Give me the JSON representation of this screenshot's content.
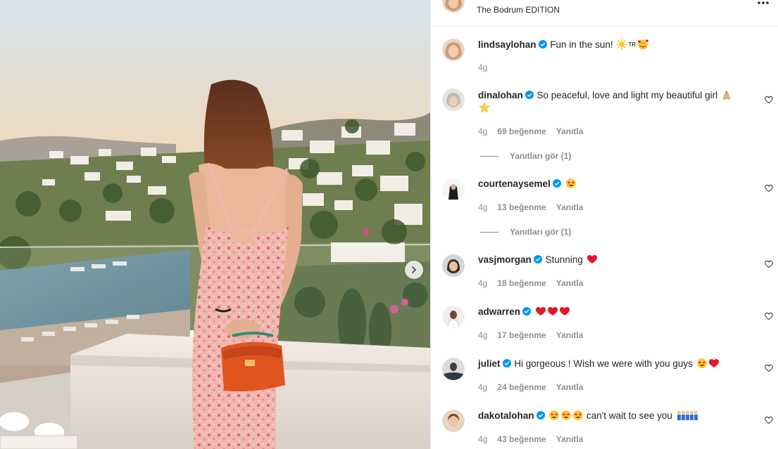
{
  "post": {
    "location": "The Bodrum EDITION",
    "more_icon": "more-horizontal-icon",
    "carousel_next_icon": "chevron-right-icon"
  },
  "colors": {
    "verified": "#0095f6",
    "heart_red": "#e0162b",
    "secondary_text": "#8e8e8e",
    "divider": "#efefef"
  },
  "caption": {
    "username": "lindsaylohan",
    "text": "Fun in the sun! ",
    "tr": "TR",
    "age": "4g"
  },
  "comments": [
    {
      "username": "dinalohan",
      "text": "So peaceful, love and light my beautiful girl",
      "age": "4g",
      "likes": "69 beğenme",
      "reply": "Yanıtla",
      "view_replies": "Yanıtları gör (1)"
    },
    {
      "username": "courtenaysemel",
      "text": "",
      "age": "4g",
      "likes": "13 beğenme",
      "reply": "Yanıtla",
      "view_replies": "Yanıtları gör (1)"
    },
    {
      "username": "vasjmorgan",
      "text": "Stunning",
      "age": "4g",
      "likes": "18 beğenme",
      "reply": "Yanıtla"
    },
    {
      "username": "adwarren",
      "text": "",
      "age": "4g",
      "likes": "17 beğenme",
      "reply": "Yanıtla"
    },
    {
      "username": "juliet",
      "text": "Hi gorgeous ! Wish we were with you guys",
      "age": "4g",
      "likes": "24 beğenme",
      "reply": "Yanıtla"
    },
    {
      "username": "dakotalohan",
      "text": "can't wait to see you",
      "age": "4g",
      "likes": "43 beğenme",
      "reply": "Yanıtla"
    }
  ]
}
